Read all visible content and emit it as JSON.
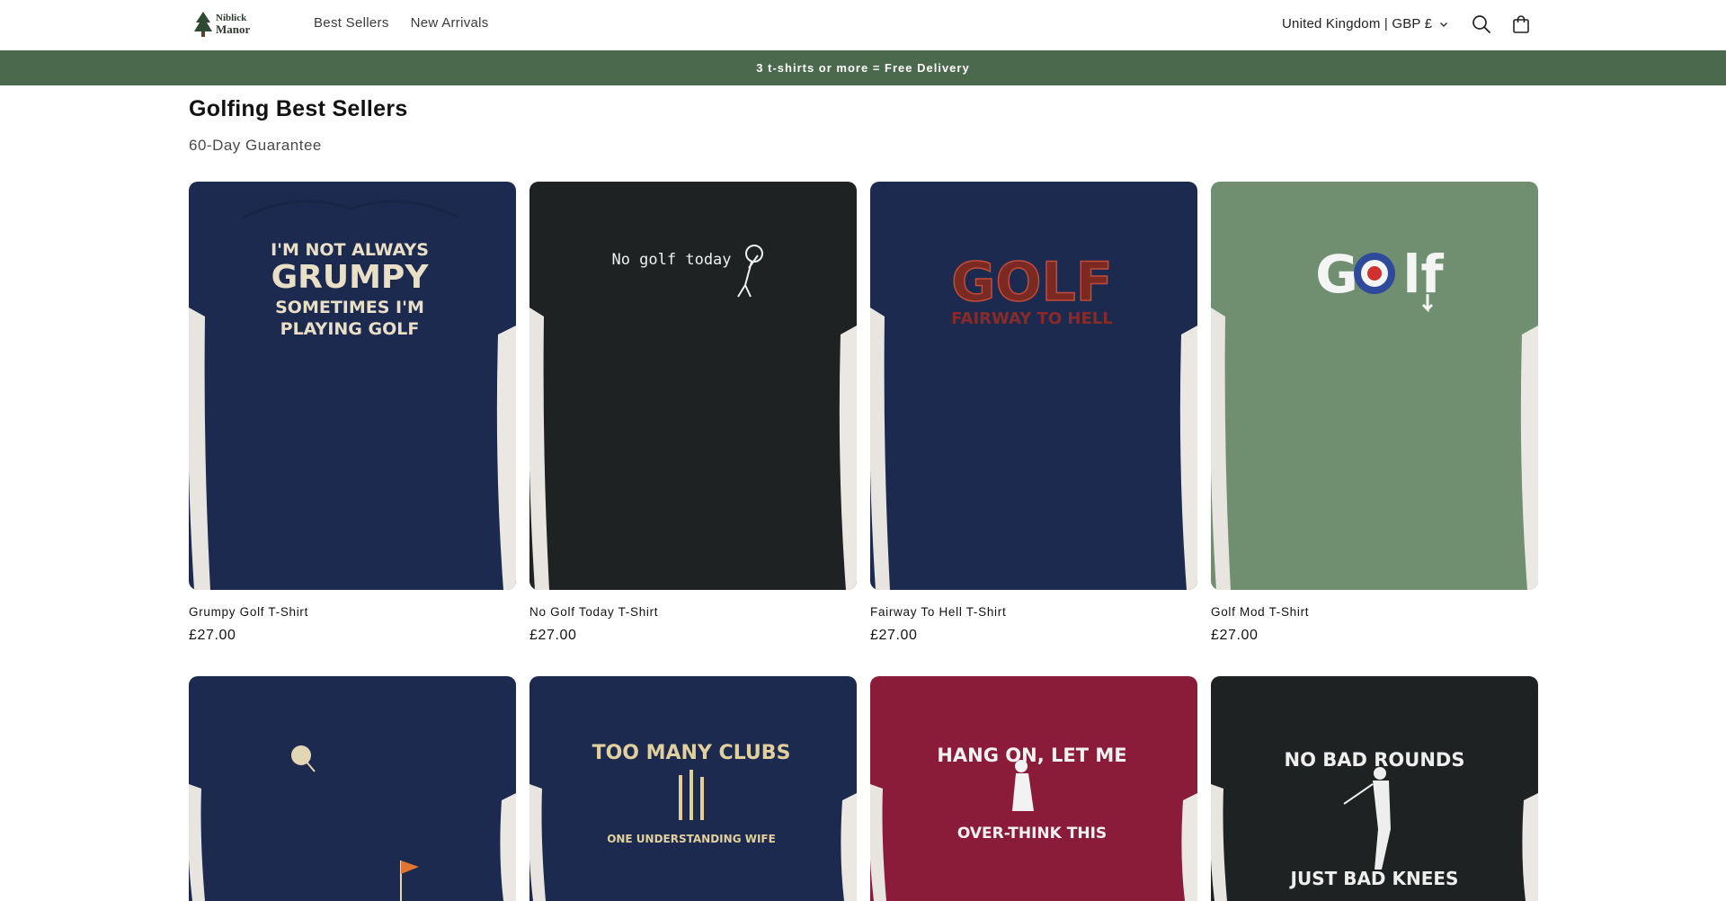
{
  "brand": {
    "name_line1": "Niblick",
    "name_line2": "Manor"
  },
  "nav": {
    "items": [
      "Best Sellers",
      "New Arrivals"
    ]
  },
  "header": {
    "locale": "United Kingdom | GBP £"
  },
  "announcement": "3 t-shirts or more = Free Delivery",
  "collection": {
    "title": "Golfing Best Sellers",
    "subtitle": "60-Day Guarantee"
  },
  "colors": {
    "announcement_bg": "#4b6a4d",
    "navy": "#1d2a4f",
    "black": "#1f2222",
    "green": "#6f8f70",
    "maroon": "#8a1c3a"
  },
  "products": [
    {
      "name": "Grumpy Golf T-Shirt",
      "price": "£27.00",
      "shirt": "navy",
      "print": [
        "I'M NOT ALWAYS",
        "GRUMPY",
        "SOMETIMES I'M",
        "PLAYING GOLF"
      ]
    },
    {
      "name": "No Golf Today T-Shirt",
      "price": "£27.00",
      "shirt": "black",
      "print": [
        "No golf today"
      ]
    },
    {
      "name": "Fairway To Hell T-Shirt",
      "price": "£27.00",
      "shirt": "navy",
      "print": [
        "GOLF",
        "FAIRWAY TO HELL"
      ]
    },
    {
      "name": "Golf Mod T-Shirt",
      "price": "£27.00",
      "shirt": "green",
      "print": [
        "G",
        "lf"
      ]
    },
    {
      "shirt": "navy",
      "print": []
    },
    {
      "shirt": "navy",
      "print": [
        "TOO MANY CLUBS",
        "ONE UNDERSTANDING WIFE"
      ]
    },
    {
      "shirt": "maroon",
      "print": [
        "HANG ON, LET ME",
        "OVER-THINK THIS"
      ]
    },
    {
      "shirt": "black",
      "print": [
        "NO BAD ROUNDS",
        "JUST BAD KNEES"
      ]
    }
  ]
}
